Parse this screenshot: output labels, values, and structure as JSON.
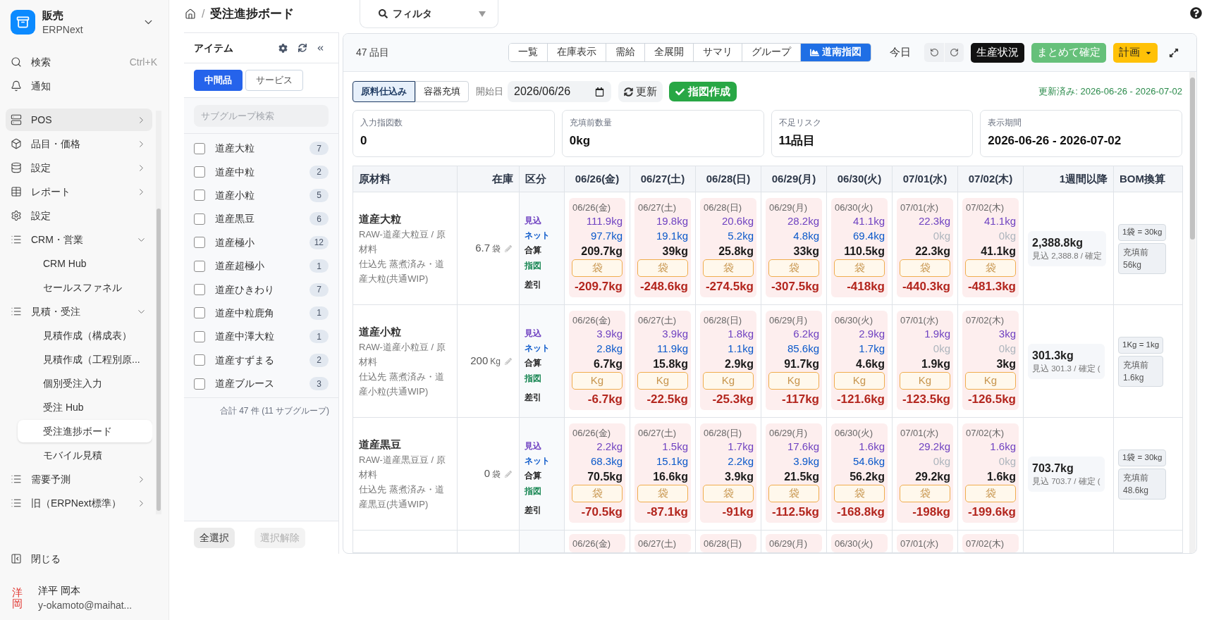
{
  "sidebar": {
    "app": {
      "title": "販売",
      "subtitle": "ERPNext"
    },
    "search": {
      "label": "検索",
      "shortcut": "Ctrl+K"
    },
    "notifications": {
      "label": "通知"
    },
    "nav": [
      {
        "label": "POS",
        "kind": "group",
        "expanded": false,
        "selected": false,
        "highlighted": true
      },
      {
        "label": "品目・価格",
        "kind": "group",
        "expanded": false,
        "selected": false,
        "highlighted": false
      },
      {
        "label": "設定",
        "kind": "group",
        "expanded": false,
        "selected": false,
        "highlighted": false
      },
      {
        "label": "レポート",
        "kind": "group",
        "expanded": false,
        "selected": false,
        "highlighted": false
      },
      {
        "label": "設定",
        "kind": "link",
        "selected": false,
        "highlighted": false
      },
      {
        "label": "CRM・営業",
        "kind": "group",
        "expanded": true,
        "selected": false,
        "highlighted": false,
        "children": [
          {
            "label": "CRM Hub",
            "selected": false
          },
          {
            "label": "セールスファネル",
            "selected": false
          }
        ]
      },
      {
        "label": "見積・受注",
        "kind": "group",
        "expanded": true,
        "selected": false,
        "highlighted": false,
        "children": [
          {
            "label": "見積作成（構成表）",
            "selected": false
          },
          {
            "label": "見積作成（工程別原...",
            "selected": false
          },
          {
            "label": "個別受注入力",
            "selected": false
          },
          {
            "label": "受注 Hub",
            "selected": false
          },
          {
            "label": "受注進捗ボード",
            "selected": true
          },
          {
            "label": "モバイル見積",
            "selected": false
          }
        ]
      },
      {
        "label": "需要予測",
        "kind": "group",
        "expanded": false,
        "selected": false,
        "highlighted": false
      },
      {
        "label": "旧（ERPNext標準）",
        "kind": "group",
        "expanded": false,
        "selected": false,
        "highlighted": false
      }
    ],
    "collapse": "閉じる",
    "user": {
      "avatar": "洋岡",
      "name": "洋平 岡本",
      "email": "y-okamoto@maihat..."
    }
  },
  "header": {
    "breadcrumb": {
      "separator": "/",
      "page": "受注進捗ボード"
    },
    "filter": {
      "label": "フィルタ"
    }
  },
  "item_panel": {
    "title": "アイテム",
    "tabs": [
      {
        "label": "中間品",
        "selected": true
      },
      {
        "label": "サービス",
        "selected": false
      }
    ],
    "search": {
      "placeholder": "サブグループ検索"
    },
    "subgroups": [
      {
        "label": "道産大粒",
        "count": "7",
        "checked": false
      },
      {
        "label": "道産中粒",
        "count": "2",
        "checked": false
      },
      {
        "label": "道産小粒",
        "count": "5",
        "checked": false
      },
      {
        "label": "道産黒豆",
        "count": "6",
        "checked": false
      },
      {
        "label": "道産極小",
        "count": "12",
        "checked": false
      },
      {
        "label": "道産超極小",
        "count": "1",
        "checked": false
      },
      {
        "label": "道産ひきわり",
        "count": "7",
        "checked": false
      },
      {
        "label": "道産中粒鹿角",
        "count": "1",
        "checked": false
      },
      {
        "label": "道産中澤大粒",
        "count": "1",
        "checked": false
      },
      {
        "label": "道産すずまる",
        "count": "2",
        "checked": false
      },
      {
        "label": "道産ブルース",
        "count": "3",
        "checked": false
      }
    ],
    "total": "合計 47 件 (11 サブグループ)",
    "actions": [
      {
        "label": "全選択",
        "disabled": false
      },
      {
        "label": "選択解除",
        "disabled": true
      }
    ]
  },
  "board": {
    "count": "47 品目",
    "views": [
      {
        "label": "一覧",
        "kind": "plain",
        "selected": false
      },
      {
        "label": "在庫表示",
        "kind": "plain",
        "selected": false
      },
      {
        "label": "需給",
        "kind": "plain",
        "selected": false
      },
      {
        "label": "全展開",
        "kind": "plain",
        "selected": false
      },
      {
        "label": "サマリ",
        "kind": "plain",
        "selected": false
      },
      {
        "label": "グループ",
        "kind": "plain",
        "selected": false
      },
      {
        "label": "道南指図",
        "kind": "chart",
        "selected": true
      }
    ],
    "today": "今日",
    "actions": [
      {
        "label": "生産状況",
        "kind": "dark"
      },
      {
        "label": "まとめて確定",
        "kind": "success"
      },
      {
        "label": "計画",
        "kind": "warning_menu"
      }
    ],
    "modes": [
      {
        "label": "原料仕込み",
        "selected": true
      },
      {
        "label": "容器充填",
        "selected": false
      }
    ],
    "start_label": "開始日",
    "start_date": "2026/06/26",
    "refresh": "更新",
    "create": "指図作成",
    "updated": "更新済み: 2026-06-26 - 2026-07-02",
    "stats": [
      {
        "label": "入力指図数",
        "value": "0"
      },
      {
        "label": "充填前数量",
        "value": "0kg"
      },
      {
        "label": "不足リスク",
        "value": "11品目"
      },
      {
        "label": "表示期間",
        "value": "2026-06-26 - 2026-07-02"
      }
    ],
    "table": {
      "columns": [
        {
          "label": "原材料",
          "kind": "material"
        },
        {
          "label": "在庫",
          "kind": "stock"
        },
        {
          "label": "区分",
          "kind": "category"
        },
        {
          "label": "06/26(金)",
          "kind": "day"
        },
        {
          "label": "06/27(土)",
          "kind": "day"
        },
        {
          "label": "06/28(日)",
          "kind": "day"
        },
        {
          "label": "06/29(月)",
          "kind": "day"
        },
        {
          "label": "06/30(火)",
          "kind": "day"
        },
        {
          "label": "07/01(水)",
          "kind": "day"
        },
        {
          "label": "07/02(木)",
          "kind": "day"
        },
        {
          "label": "1週間以降",
          "kind": "later"
        },
        {
          "label": "BOM換算",
          "kind": "bom"
        }
      ],
      "rows": [
        {
          "name": "道産大粒",
          "code": "RAW-道産大粒豆 / 原材料",
          "supplier": "仕込先 蒸煮済み・道産大粒(共通WIP)",
          "stock": "6.7",
          "stock_unit": "袋",
          "labels": [
            {
              "kind": "forecast",
              "text": "見込"
            },
            {
              "kind": "net",
              "text": "ネット"
            },
            {
              "kind": "total",
              "text": "合算"
            },
            {
              "kind": "order",
              "text": "指図"
            },
            {
              "kind": "diff",
              "text": "差引"
            }
          ],
          "days": [
            {
              "date": "06/26(金)",
              "shortage": true,
              "forecast": "111.9kg",
              "net": "97.7kg",
              "net_muted": false,
              "total": "209.7kg",
              "unit": "袋",
              "diff": "-209.7kg"
            },
            {
              "date": "06/27(土)",
              "shortage": true,
              "forecast": "19.8kg",
              "net": "19.1kg",
              "net_muted": false,
              "total": "39kg",
              "unit": "袋",
              "diff": "-248.6kg"
            },
            {
              "date": "06/28(日)",
              "shortage": true,
              "forecast": "20.6kg",
              "net": "5.2kg",
              "net_muted": false,
              "total": "25.8kg",
              "unit": "袋",
              "diff": "-274.5kg"
            },
            {
              "date": "06/29(月)",
              "shortage": true,
              "forecast": "28.2kg",
              "net": "4.8kg",
              "net_muted": false,
              "total": "33kg",
              "unit": "袋",
              "diff": "-307.5kg"
            },
            {
              "date": "06/30(火)",
              "shortage": true,
              "forecast": "41.1kg",
              "net": "69.4kg",
              "net_muted": false,
              "total": "110.5kg",
              "unit": "袋",
              "diff": "-418kg"
            },
            {
              "date": "07/01(水)",
              "shortage": true,
              "forecast": "22.3kg",
              "net": "0kg",
              "net_muted": true,
              "total": "22.3kg",
              "unit": "袋",
              "diff": "-440.3kg"
            },
            {
              "date": "07/02(木)",
              "shortage": true,
              "forecast": "41.1kg",
              "net": "0kg",
              "net_muted": true,
              "total": "41.1kg",
              "unit": "袋",
              "diff": "-481.3kg"
            }
          ],
          "later": {
            "value": "2,388.8kg",
            "detail": "見込 2,388.8 / 確定"
          },
          "bom": {
            "ratio": "1袋 = 30kg",
            "label": "充填前",
            "amount": "56kg"
          }
        },
        {
          "name": "道産小粒",
          "code": "RAW-道産小粒豆 / 原材料",
          "supplier": "仕込先 蒸煮済み・道産小粒(共通WIP)",
          "stock": "200",
          "stock_unit": "Kg",
          "labels": [
            {
              "kind": "forecast",
              "text": "見込"
            },
            {
              "kind": "net",
              "text": "ネット"
            },
            {
              "kind": "total",
              "text": "合算"
            },
            {
              "kind": "order",
              "text": "指図"
            },
            {
              "kind": "diff",
              "text": "差引"
            }
          ],
          "days": [
            {
              "date": "06/26(金)",
              "shortage": true,
              "forecast": "3.9kg",
              "net": "2.8kg",
              "net_muted": false,
              "total": "6.7kg",
              "unit": "Kg",
              "diff": "-6.7kg"
            },
            {
              "date": "06/27(土)",
              "shortage": true,
              "forecast": "3.9kg",
              "net": "11.9kg",
              "net_muted": false,
              "total": "15.8kg",
              "unit": "Kg",
              "diff": "-22.5kg"
            },
            {
              "date": "06/28(日)",
              "shortage": true,
              "forecast": "1.8kg",
              "net": "1.1kg",
              "net_muted": false,
              "total": "2.9kg",
              "unit": "Kg",
              "diff": "-25.3kg"
            },
            {
              "date": "06/29(月)",
              "shortage": true,
              "forecast": "6.2kg",
              "net": "85.6kg",
              "net_muted": false,
              "total": "91.7kg",
              "unit": "Kg",
              "diff": "-117kg"
            },
            {
              "date": "06/30(火)",
              "shortage": true,
              "forecast": "2.9kg",
              "net": "1.7kg",
              "net_muted": false,
              "total": "4.6kg",
              "unit": "Kg",
              "diff": "-121.6kg"
            },
            {
              "date": "07/01(水)",
              "shortage": true,
              "forecast": "1.9kg",
              "net": "0kg",
              "net_muted": true,
              "total": "1.9kg",
              "unit": "Kg",
              "diff": "-123.5kg"
            },
            {
              "date": "07/02(木)",
              "shortage": true,
              "forecast": "3kg",
              "net": "0kg",
              "net_muted": true,
              "total": "3kg",
              "unit": "Kg",
              "diff": "-126.5kg"
            }
          ],
          "later": {
            "value": "301.3kg",
            "detail": "見込 301.3 / 確定 ("
          },
          "bom": {
            "ratio": "1Kg = 1kg",
            "label": "充填前",
            "amount": "1.6kg"
          }
        },
        {
          "name": "道産黒豆",
          "code": "RAW-道産黒豆豆 / 原材料",
          "supplier": "仕込先 蒸煮済み・道産黒豆(共通WIP)",
          "stock": "0",
          "stock_unit": "袋",
          "labels": [
            {
              "kind": "forecast",
              "text": "見込"
            },
            {
              "kind": "net",
              "text": "ネット"
            },
            {
              "kind": "total",
              "text": "合算"
            },
            {
              "kind": "order",
              "text": "指図"
            },
            {
              "kind": "diff",
              "text": "差引"
            }
          ],
          "days": [
            {
              "date": "06/26(金)",
              "shortage": true,
              "forecast": "2.2kg",
              "net": "68.3kg",
              "net_muted": false,
              "total": "70.5kg",
              "unit": "袋",
              "diff": "-70.5kg"
            },
            {
              "date": "06/27(土)",
              "shortage": true,
              "forecast": "1.5kg",
              "net": "15.1kg",
              "net_muted": false,
              "total": "16.6kg",
              "unit": "袋",
              "diff": "-87.1kg"
            },
            {
              "date": "06/28(日)",
              "shortage": true,
              "forecast": "1.7kg",
              "net": "2.2kg",
              "net_muted": false,
              "total": "3.9kg",
              "unit": "袋",
              "diff": "-91kg"
            },
            {
              "date": "06/29(月)",
              "shortage": true,
              "forecast": "17.6kg",
              "net": "3.9kg",
              "net_muted": false,
              "total": "21.5kg",
              "unit": "袋",
              "diff": "-112.5kg"
            },
            {
              "date": "06/30(火)",
              "shortage": true,
              "forecast": "1.6kg",
              "net": "54.6kg",
              "net_muted": false,
              "total": "56.2kg",
              "unit": "袋",
              "diff": "-168.8kg"
            },
            {
              "date": "07/01(水)",
              "shortage": true,
              "forecast": "29.2kg",
              "net": "0kg",
              "net_muted": true,
              "total": "29.2kg",
              "unit": "袋",
              "diff": "-198kg"
            },
            {
              "date": "07/02(木)",
              "shortage": true,
              "forecast": "1.6kg",
              "net": "0kg",
              "net_muted": true,
              "total": "1.6kg",
              "unit": "袋",
              "diff": "-199.6kg"
            }
          ],
          "later": {
            "value": "703.7kg",
            "detail": "見込 703.7 / 確定 ("
          },
          "bom": {
            "ratio": "1袋 = 30kg",
            "label": "充填前",
            "amount": "48.6kg"
          }
        },
        {
          "days": [
            {
              "date": "06/26(金)",
              "shortage": true
            },
            {
              "date": "06/27(土)",
              "shortage": true
            },
            {
              "date": "06/28(日)",
              "shortage": true
            },
            {
              "date": "06/29(月)",
              "shortage": true
            },
            {
              "date": "06/30(火)",
              "shortage": true
            },
            {
              "date": "07/01(水)",
              "shortage": true
            },
            {
              "date": "07/02(木)",
              "shortage": true
            }
          ]
        }
      ]
    }
  }
}
